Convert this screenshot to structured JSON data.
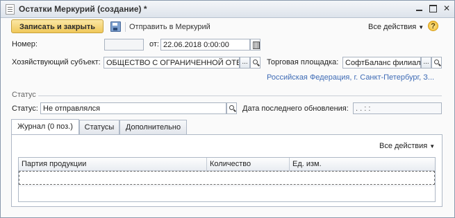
{
  "window": {
    "title": "Остатки Меркурий (создание) *"
  },
  "toolbar": {
    "save_close": "Записать и закрыть",
    "send": "Отправить в Меркурий",
    "all_actions": "Все действия",
    "help": "?"
  },
  "fields": {
    "number_label": "Номер:",
    "number_value": "",
    "from_label": "от:",
    "date_value": "22.06.2018  0:00:00",
    "entity_label": "Хозяйствующий субъект:",
    "entity_value": "ОБЩЕСТВО С ОГРАНИЧЕННОЙ ОТВ",
    "platform_label": "Торговая площадка:",
    "platform_value": "СофтБаланс филиал",
    "address": "Российская Федерация, г. Санкт-Петербург, З..."
  },
  "status_section": {
    "title": "Статус",
    "status_label": "Статус:",
    "status_value": "Не отправлялся",
    "updated_label": "Дата последнего обновления:",
    "updated_value": " .  .      :  :"
  },
  "tabs": [
    {
      "label": "Журнал (0 поз.)",
      "active": true
    },
    {
      "label": "Статусы",
      "active": false
    },
    {
      "label": "Дополнительно",
      "active": false
    }
  ],
  "panel": {
    "all_actions": "Все действия"
  },
  "table": {
    "columns": [
      "Партия продукции",
      "Количество",
      "Ед. изм."
    ],
    "rows": []
  },
  "icons": [
    "document-icon",
    "save-icon",
    "help-icon",
    "select-button-icon",
    "search-icon",
    "calendar-icon",
    "minimize-icon",
    "maximize-icon",
    "close-icon"
  ]
}
